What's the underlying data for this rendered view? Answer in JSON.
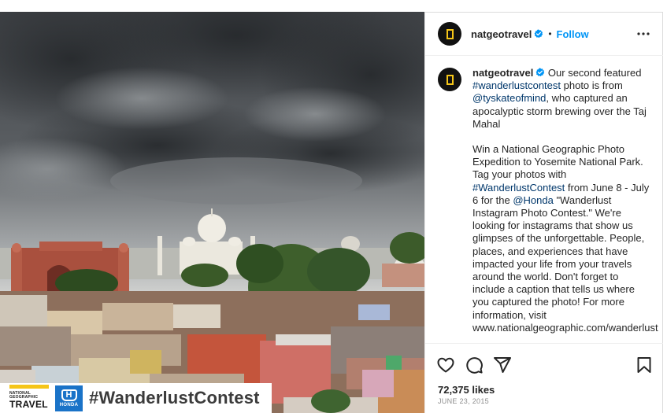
{
  "post": {
    "account": "natgeotravel",
    "follow_label": "Follow",
    "separator": "•",
    "banner": {
      "brand_small": "NATIONAL GEOGRAPHIC",
      "brand_big": "TRAVEL",
      "sponsor_letter": "H",
      "sponsor_name": "HONDA",
      "hashtag": "#WanderlustContest"
    },
    "caption": {
      "p1_text1": " Our second featured ",
      "p1_tag": "#wanderlustcontest",
      "p1_text2": " photo is from ",
      "p1_mention": "@tyskateofmind",
      "p1_text3": ", who captured an apocalyptic storm brewing over the Taj Mahal",
      "p2_text1": "Win a National Geographic Photo Expedition to Yosemite National Park. Tag your photos with ",
      "p2_tag": "#WanderlustContest",
      "p2_text2": " from June 8 - July 6 for the ",
      "p2_mention": "@Honda",
      "p2_text3": " \"Wanderlust Instagram Photo Contest.\" We're looking for instagrams that show us glimpses of the unforgettable. People, places, and experiences that have impacted your life from your travels around the world. Don't forget to include a caption that tells us where you captured the photo! For more information, visit www.nationalgeographic.com/wanderlust"
    },
    "likes": "72,375 likes",
    "date": "JUNE 23, 2015"
  },
  "icons": {
    "verified": "verified-badge-icon",
    "more": "more-options-icon",
    "like": "heart-icon",
    "comment": "comment-icon",
    "share": "share-icon",
    "save": "bookmark-icon"
  },
  "colors": {
    "link": "#00376b",
    "follow": "#0095f6",
    "verified": "#0095f6",
    "ng_yellow": "#f5c518",
    "honda_blue": "#1a73c8"
  }
}
